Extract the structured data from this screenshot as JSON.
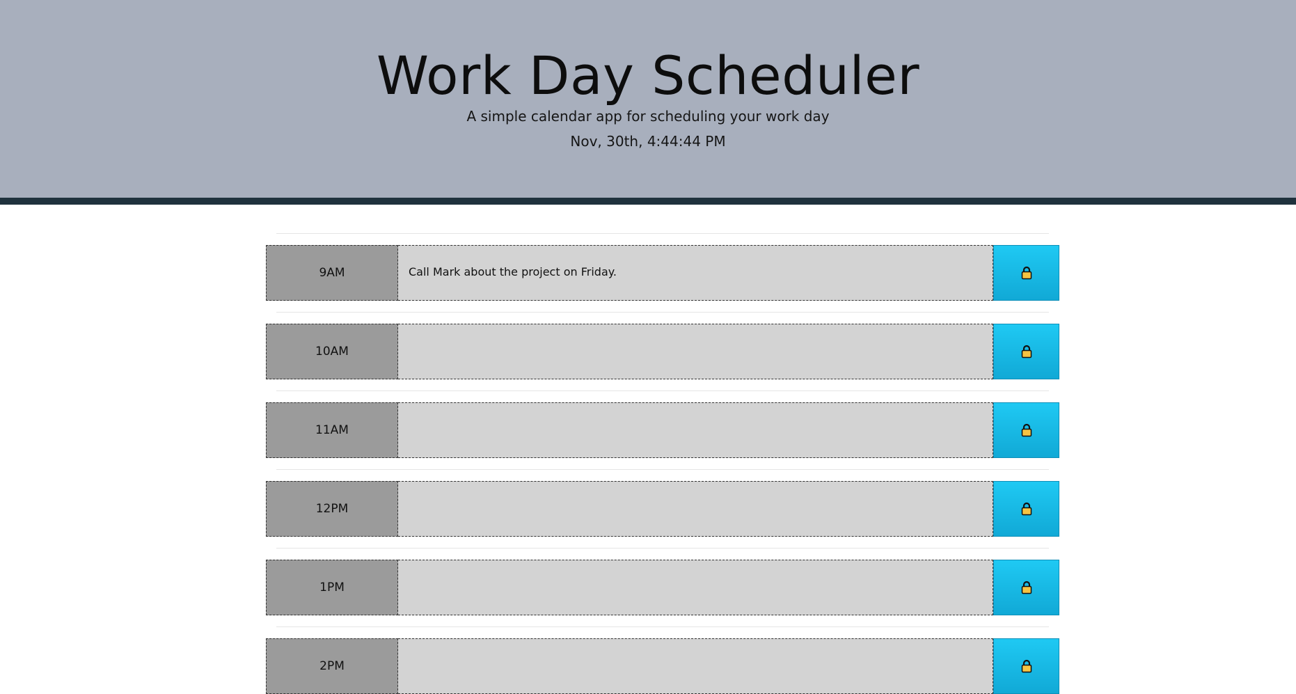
{
  "header": {
    "title": "Work Day Scheduler",
    "subtitle": "A simple calendar app for scheduling your work day",
    "current_day": "Nov, 30th, 4:44:44 PM"
  },
  "colors": {
    "header_bg": "#a8afbd",
    "header_border": "#1f323d",
    "hour_bg": "#9b9b9b",
    "description_bg": "#d3d3d3",
    "save_button": "#1fc9f3",
    "lock_icon": "#f6c342"
  },
  "time_blocks": [
    {
      "hour": "9AM",
      "description": "Call Mark about the project on Friday.",
      "save_icon": "lock-icon"
    },
    {
      "hour": "10AM",
      "description": "",
      "save_icon": "lock-icon"
    },
    {
      "hour": "11AM",
      "description": "",
      "save_icon": "lock-icon"
    },
    {
      "hour": "12PM",
      "description": "",
      "save_icon": "lock-icon"
    },
    {
      "hour": "1PM",
      "description": "",
      "save_icon": "lock-icon"
    },
    {
      "hour": "2PM",
      "description": "",
      "save_icon": "lock-icon"
    }
  ]
}
